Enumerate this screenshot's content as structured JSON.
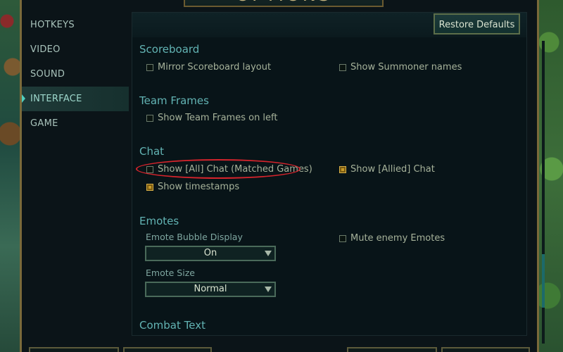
{
  "window": {
    "title": "OPTIONS"
  },
  "sidebar": {
    "items": [
      {
        "label": "HOTKEYS",
        "active": false
      },
      {
        "label": "VIDEO",
        "active": false
      },
      {
        "label": "SOUND",
        "active": false
      },
      {
        "label": "INTERFACE",
        "active": true
      },
      {
        "label": "GAME",
        "active": false
      }
    ]
  },
  "toolbar": {
    "restore_label": "Restore Defaults"
  },
  "sections": {
    "scoreboard": {
      "title": "Scoreboard",
      "mirror": {
        "label": "Mirror Scoreboard layout",
        "checked": false
      },
      "summoner_names": {
        "label": "Show Summoner names",
        "checked": false
      }
    },
    "team_frames": {
      "title": "Team Frames",
      "left": {
        "label": "Show Team Frames on left",
        "checked": false
      }
    },
    "chat": {
      "title": "Chat",
      "all_chat": {
        "label": "Show [All] Chat (Matched Games)",
        "checked": false
      },
      "allied_chat": {
        "label": "Show [Allied] Chat",
        "checked": true
      },
      "timestamps": {
        "label": "Show timestamps",
        "checked": true
      }
    },
    "emotes": {
      "title": "Emotes",
      "bubble_label": "Emote Bubble Display",
      "bubble_value": "On",
      "size_label": "Emote Size",
      "size_value": "Normal",
      "mute_enemy": {
        "label": "Mute enemy Emotes",
        "checked": false
      }
    },
    "combat_text": {
      "title": "Combat Text"
    }
  },
  "colors": {
    "accent": "#62b3b3",
    "checkbox_checked": "#c69a28",
    "highlight": "#d4242c"
  }
}
